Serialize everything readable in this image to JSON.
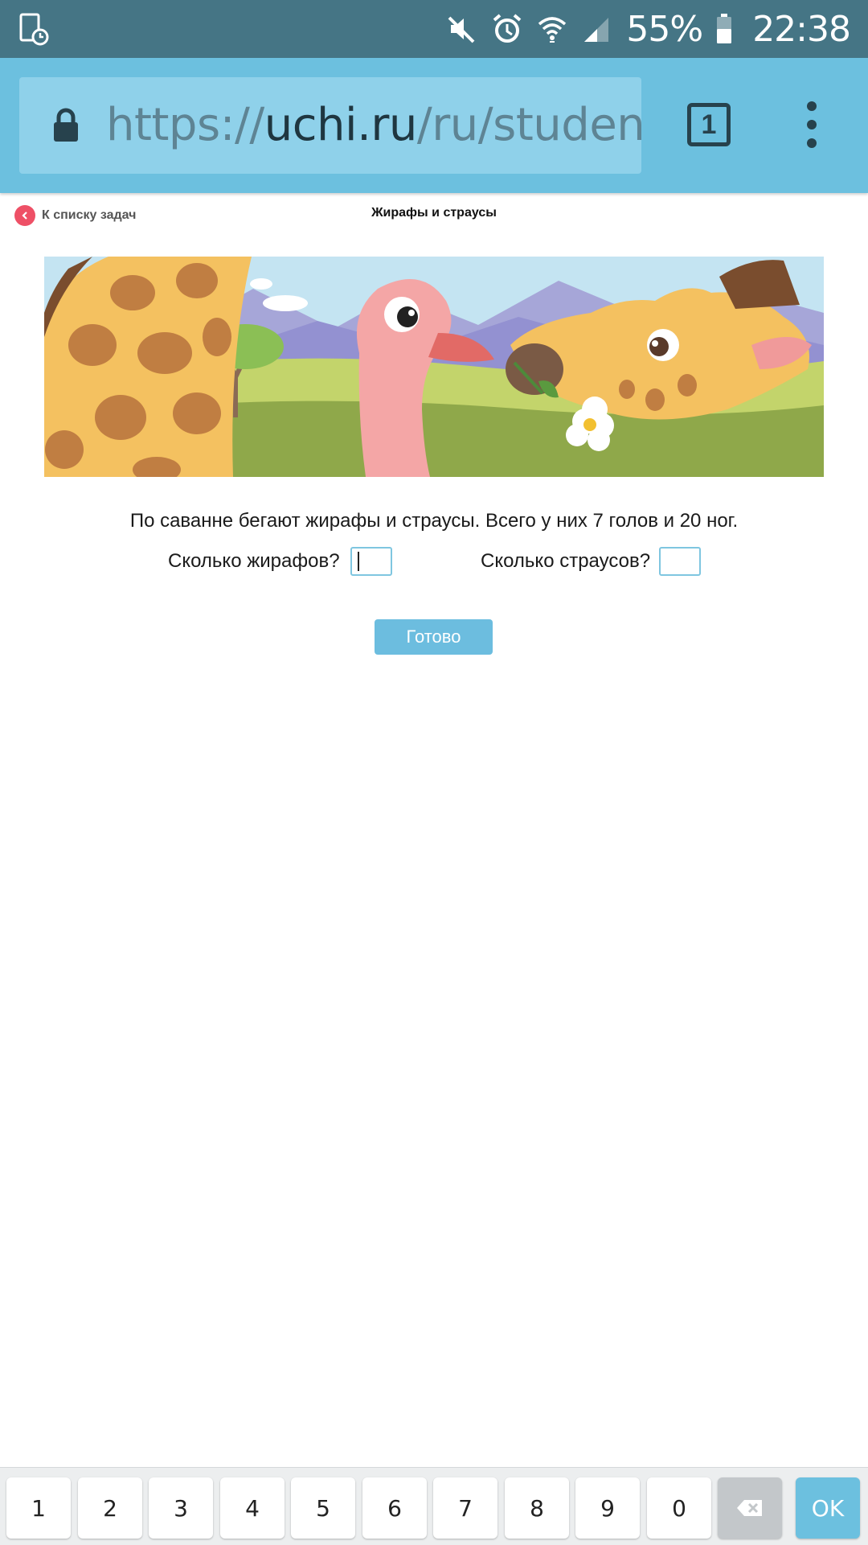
{
  "status_bar": {
    "battery": "55%",
    "time": "22:38",
    "icons": [
      "screenshot-timer-icon",
      "mute-icon",
      "alarm-icon",
      "wifi-icon",
      "signal-icon",
      "battery-icon"
    ]
  },
  "browser": {
    "url_scheme": "https://",
    "url_domain": "uchi.ru",
    "url_path": "/ru/students/",
    "tab_count": "1",
    "icons": [
      "lock-icon",
      "more-vert-icon"
    ]
  },
  "page": {
    "back_label": "К списку задач",
    "title": "Жирафы и страусы"
  },
  "task": {
    "text": "По саванне бегают жирафы и страусы. Всего у них 7 голов и 20 ног.",
    "question_giraffes": "Сколько жирафов?",
    "question_ostriches": "Сколько страусов?",
    "answer_giraffes": "",
    "answer_ostriches": "",
    "done_label": "Готово"
  },
  "keypad": {
    "keys": [
      "1",
      "2",
      "3",
      "4",
      "5",
      "6",
      "7",
      "8",
      "9",
      "0"
    ],
    "ok_label": "OK"
  },
  "colors": {
    "status_bar": "#457585",
    "browser_bar": "#6cc0df",
    "accent": "#6cbddf",
    "back_button": "#ee5066"
  }
}
